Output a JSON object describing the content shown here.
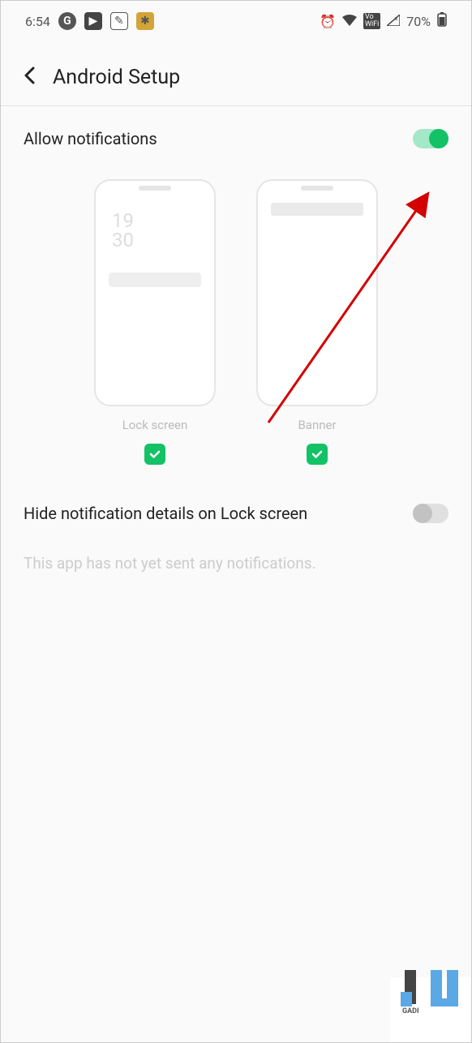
{
  "status": {
    "time": "6:54",
    "battery": "70%"
  },
  "header": {
    "title": "Android Setup"
  },
  "allow_notifications": {
    "label": "Allow notifications"
  },
  "previews": {
    "lock_screen": {
      "label": "Lock screen",
      "time_line1": "19",
      "time_line2": "30"
    },
    "banner": {
      "label": "Banner"
    }
  },
  "hide_details": {
    "label": "Hide notification details on Lock screen"
  },
  "message": "This app has not yet sent any notifications.",
  "watermark": "GADI"
}
